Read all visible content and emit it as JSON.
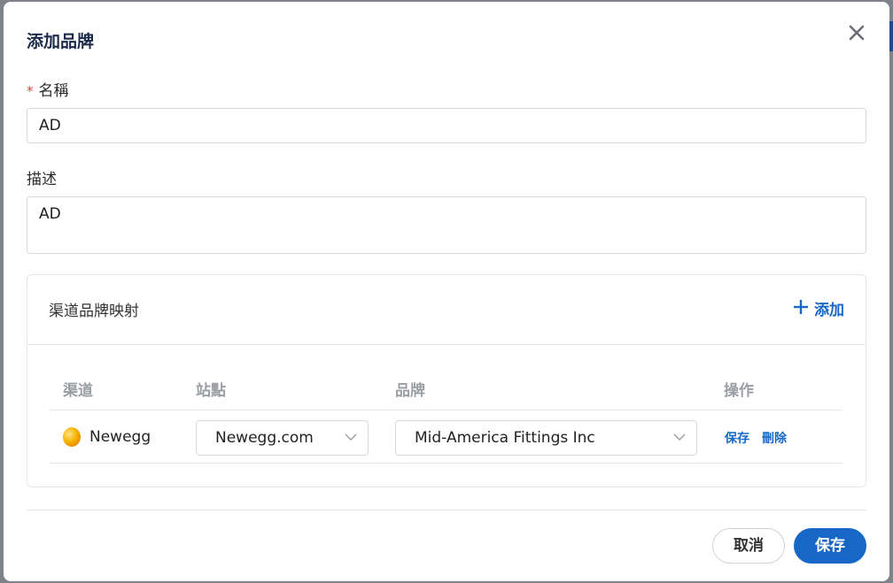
{
  "dialog": {
    "title": "添加品牌",
    "close_icon": "close-icon"
  },
  "form": {
    "name_required_mark": "*",
    "name_label": "名稱",
    "name_value": "AD",
    "description_label": "描述",
    "description_value": "AD"
  },
  "mapping": {
    "title": "渠道品牌映射",
    "add_label": "添加",
    "add_icon": "plus-icon",
    "columns": [
      "渠道",
      "站點",
      "品牌",
      "操作"
    ],
    "rows": [
      {
        "channel": "Newegg",
        "channel_icon": "newegg-egg-icon",
        "site": "Newegg.com",
        "brand": "Mid-America Fittings Inc",
        "actions": [
          "保存",
          "刪除"
        ]
      }
    ]
  },
  "footer": {
    "cancel_label": "取消",
    "save_label": "保存"
  },
  "colors": {
    "accent": "#1767c6",
    "required": "#e0443e",
    "title": "#1c2a4a"
  }
}
